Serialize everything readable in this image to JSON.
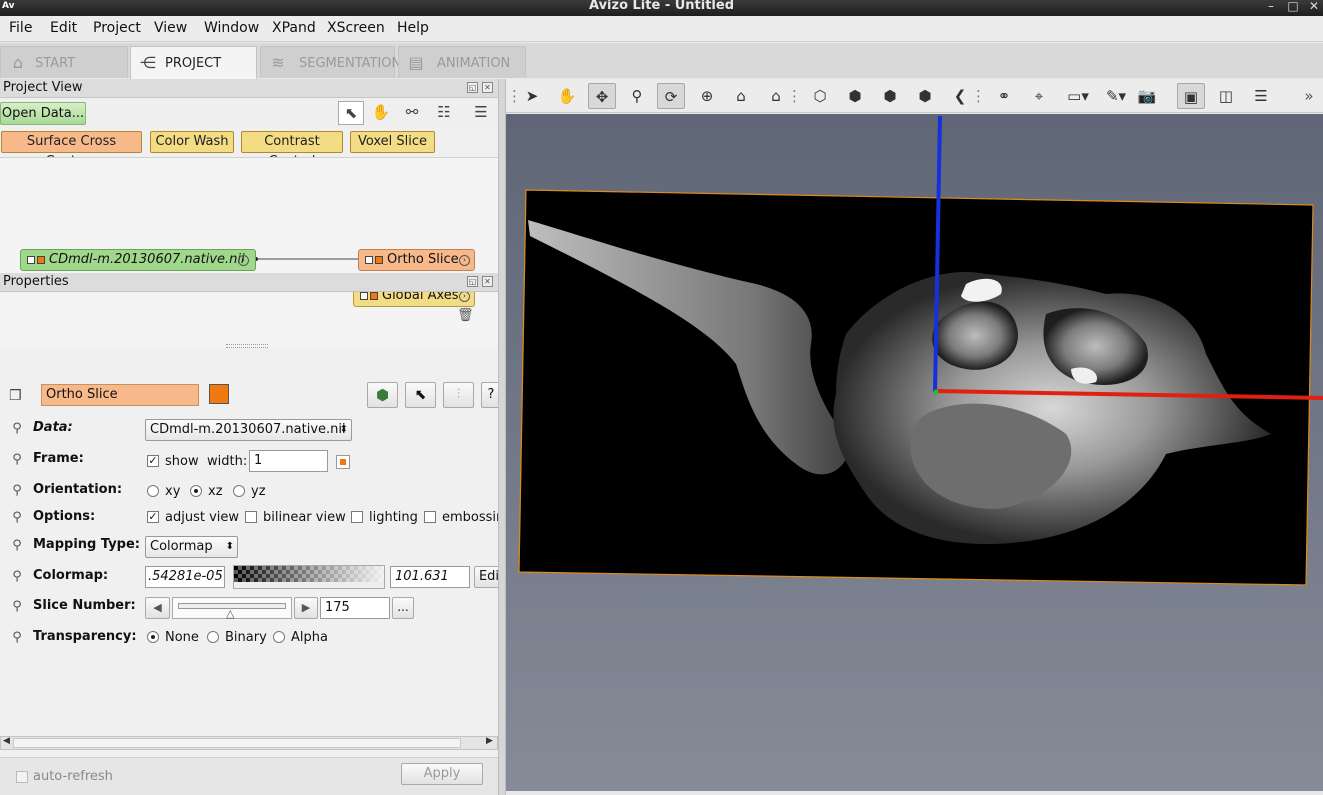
{
  "window": {
    "logo": "Av",
    "title": "Avizo Lite - Untitled",
    "controls": [
      "–",
      "□",
      "✕"
    ]
  },
  "menu": [
    "File",
    "Edit",
    "Project",
    "View",
    "Window",
    "XPand",
    "XScreen",
    "Help"
  ],
  "tabs": [
    {
      "label": "START",
      "icon": "home-icon",
      "active": false
    },
    {
      "label": "PROJECT",
      "icon": "project-graph-icon",
      "active": true
    },
    {
      "label": "SEGMENTATION",
      "icon": "layers-icon",
      "active": false
    },
    {
      "label": "ANIMATION",
      "icon": "film-icon",
      "active": false
    }
  ],
  "project_view": {
    "title": "Project View",
    "open_data": "Open Data...",
    "quick_buttons": [
      "Surface Cross Contour",
      "Color Wash",
      "Contrast Control",
      "Voxel Slice"
    ],
    "data_node": "CDmdl-m.20130607.native.nii",
    "module_nodes": [
      "Ortho Slice",
      "Global Axes"
    ]
  },
  "properties": {
    "title": "Properties",
    "module_name": "Ortho Slice",
    "module_color": "#f07a10",
    "data": {
      "label": "Data:",
      "value": "CDmdl-m.20130607.native.nii"
    },
    "frame": {
      "label": "Frame:",
      "show_label": "show",
      "show_checked": true,
      "width_label": "width:",
      "width_value": "1"
    },
    "orientation": {
      "label": "Orientation:",
      "options": [
        "xy",
        "xz",
        "yz"
      ],
      "selected": "xz"
    },
    "options": {
      "label": "Options:",
      "items": [
        {
          "label": "adjust view",
          "checked": true
        },
        {
          "label": "bilinear view",
          "checked": false
        },
        {
          "label": "lighting",
          "checked": false
        },
        {
          "label": "embossin",
          "checked": false
        }
      ]
    },
    "mapping_type": {
      "label": "Mapping Type:",
      "value": "Colormap"
    },
    "colormap": {
      "label": "Colormap:",
      "min": ".54281e-05",
      "max": "101.631",
      "edit_label": "Edi"
    },
    "slice_number": {
      "label": "Slice Number:",
      "value": "175",
      "more": "...",
      "slider_fraction": 0.5
    },
    "transparency": {
      "label": "Transparency:",
      "options": [
        "None",
        "Binary",
        "Alpha"
      ],
      "selected": "None"
    },
    "auto_refresh": "auto-refresh",
    "apply": "Apply"
  },
  "viewer": {
    "frame_color": "#e08a1c",
    "axis_colors": {
      "x": "#e02010",
      "z": "#1530e0"
    }
  }
}
